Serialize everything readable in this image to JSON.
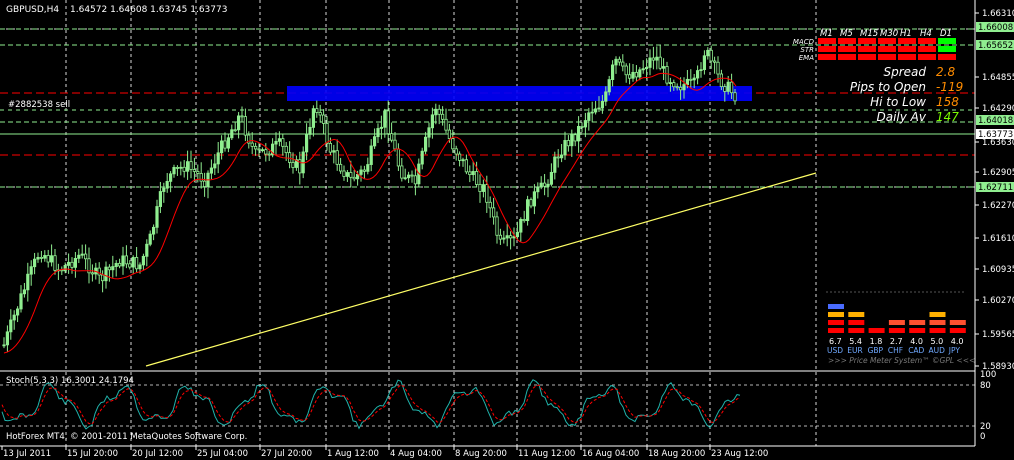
{
  "window_title": "GBPUSD,H4",
  "ohlc": "1.64572 1.64608 1.63745 1.63773",
  "order_label": "#2882538 sell",
  "copyright": "HotForex MT4, © 2001-2011 MetaQuotes Software Corp.",
  "stoch_label": "Stoch(5,3,3) 16.3001 24.1794",
  "colors": {
    "background": "#000000",
    "candle": "#90EE90",
    "ma": "#FF0000",
    "trendline": "#FFFF66",
    "zone": "#0000FF",
    "dashed_red": "#FF0000",
    "grid": "#FFFFFF"
  },
  "price_axis": {
    "labels": [
      "1.66310",
      "1.64855",
      "1.64290",
      "1.63630",
      "1.62905",
      "1.62270",
      "1.61610",
      "1.60935",
      "1.60270",
      "1.59565",
      "1.58930"
    ],
    "highlighted": [
      {
        "label": "1.66008",
        "bg": "#90EE90",
        "fg": "#000000"
      },
      {
        "label": "1.65652",
        "bg": "#90EE90",
        "fg": "#000000"
      },
      {
        "label": "1.64018",
        "bg": "#90EE90",
        "fg": "#000000"
      },
      {
        "label": "1.63773",
        "bg": "#FFFFFF",
        "fg": "#000000"
      },
      {
        "label": "1.62711",
        "bg": "#90EE90",
        "fg": "#000000"
      }
    ]
  },
  "time_axis": {
    "labels": [
      "13 Jul 2011",
      "15 Jul 20:00",
      "20 Jul 12:00",
      "25 Jul 04:00",
      "27 Jul 20:00",
      "1 Aug 12:00",
      "4 Aug 04:00",
      "8 Aug 20:00",
      "11 Aug 12:00",
      "16 Aug 04:00",
      "18 Aug 20:00",
      "23 Aug 12:00"
    ]
  },
  "stoch_axis": {
    "labels": [
      "100",
      "80",
      "20",
      "0"
    ]
  },
  "signal_panel": {
    "timeframes": [
      "M1",
      "M5",
      "M15",
      "M30",
      "H1",
      "H4",
      "D1"
    ],
    "rows": [
      {
        "label": "MACD",
        "colors": [
          "#FF0000",
          "#FF0000",
          "#FF0000",
          "#FF0000",
          "#FF0000",
          "#FF0000",
          "#00FF00"
        ]
      },
      {
        "label": "STR",
        "colors": [
          "#FF0000",
          "#FF0000",
          "#FF0000",
          "#FF0000",
          "#FF0000",
          "#FF0000",
          "#00FF00"
        ]
      },
      {
        "label": "EMA",
        "colors": [
          "#FF0000",
          "#FF0000",
          "#FF0000",
          "#FF0000",
          "#FF0000",
          "#FF0000",
          "#FF0000"
        ]
      }
    ]
  },
  "stats": [
    {
      "label": "Spread",
      "value": "2.8",
      "color": "#FF8C00"
    },
    {
      "label": "Pips to Open",
      "value": "-119",
      "color": "#FF8C00"
    },
    {
      "label": "Hi to Low",
      "value": "158",
      "color": "#FF8C00"
    },
    {
      "label": "Daily Av",
      "value": "147",
      "color": "#7CFC00"
    }
  ],
  "price_meter": {
    "currencies": [
      {
        "name": "USD",
        "value": "6.7",
        "bars": [
          "#FF0000",
          "#FF0000",
          "#FFB000",
          "#4A6CFF"
        ]
      },
      {
        "name": "EUR",
        "value": "5.4",
        "bars": [
          "#FF0000",
          "#FF0000",
          "#FFB000"
        ]
      },
      {
        "name": "GBP",
        "value": "1.8",
        "bars": [
          "#FF0000"
        ]
      },
      {
        "name": "CHF",
        "value": "2.7",
        "bars": [
          "#FF0000",
          "#FF5030"
        ]
      },
      {
        "name": "CAD",
        "value": "4.0",
        "bars": [
          "#FF0000",
          "#FF5030"
        ]
      },
      {
        "name": "AUD",
        "value": "5.0",
        "bars": [
          "#FF0000",
          "#FF5030",
          "#FFB000"
        ]
      },
      {
        "name": "JPY",
        "value": "4.0",
        "bars": [
          "#FF0000",
          "#FF5030"
        ]
      }
    ],
    "footer": ">>> Price Meter System™ ©GPL <<<"
  }
}
